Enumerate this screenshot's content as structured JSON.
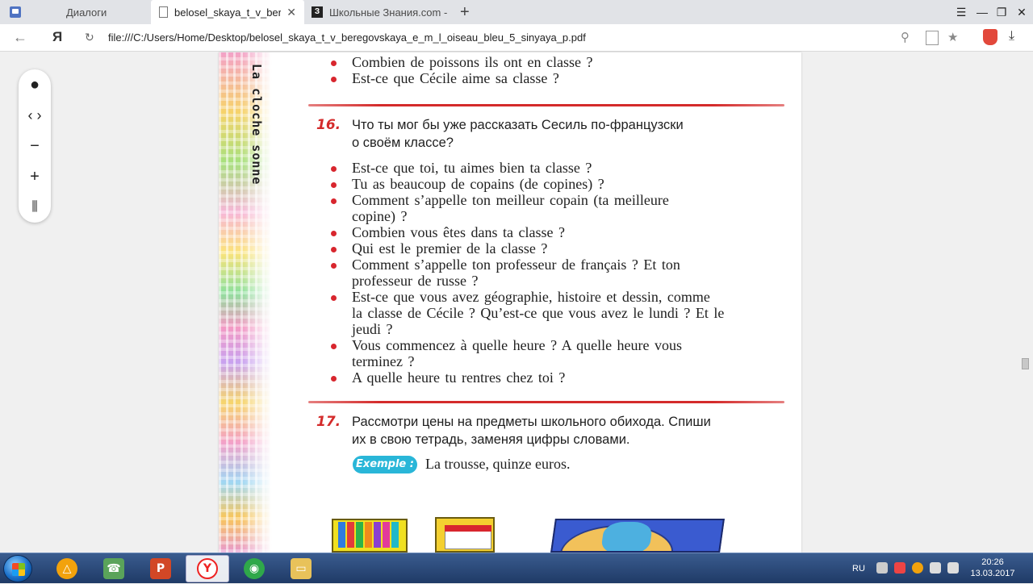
{
  "browser": {
    "tabs": [
      {
        "label": "Диалоги"
      },
      {
        "label": "belosel_skaya_t_v_beregovskaya"
      },
      {
        "label": "Школьные Знания.com - Ре"
      }
    ],
    "url": "file:///C:/Users/Home/Desktop/belosel_skaya_t_v_beregovskaya_e_m_l_oiseau_bleu_5_sinyaya_p.pdf",
    "logo_letter": "Я"
  },
  "document": {
    "side_title": "La cloche sonne",
    "top_lines": [
      "Combien de poissons ils ont en classe ?",
      "Est-ce que Cécile aime sa classe ?"
    ],
    "ex16": {
      "number": "16.",
      "task_lines": [
        "Что ты мог бы уже рассказать Сесиль по-французски",
        "о своём классе?"
      ],
      "lines": [
        "Est-ce que toi, tu aimes bien ta classe ?",
        "Tu as beaucoup de copains (de copines) ?",
        "Comment s’appelle ton meilleur copain (ta meilleure",
        "copine) ?",
        "Combien vous êtes dans ta classe ?",
        "Qui est le premier de la classe ?",
        "Comment s’appelle ton professeur de français ? Et ton",
        "professeur de russe ?",
        "Est-ce que vous avez géographie, histoire et dessin, comme",
        "la classe de Cécile ? Qu’est-ce que vous avez le lundi ? Et le",
        "jeudi ?",
        "Vous commencez à quelle heure ? A quelle heure vous",
        "terminez ?",
        "A quelle heure tu rentres chez toi ?"
      ]
    },
    "ex17": {
      "number": "17.",
      "task_lines": [
        "Рассмотри цены на предметы школьного обихода. Спиши",
        "их в свою тетрадь, заменяя цифры словами."
      ],
      "example_tag": "Exemple :",
      "example_text": "La trousse, quinze euros."
    }
  },
  "taskbar": {
    "lang": "RU",
    "time": "20:26",
    "date": "13.03.2017"
  },
  "colors": {
    "accent_red": "#d42b2b",
    "example_blue": "#29b6d8",
    "taskbar": "#2a4a7a"
  }
}
